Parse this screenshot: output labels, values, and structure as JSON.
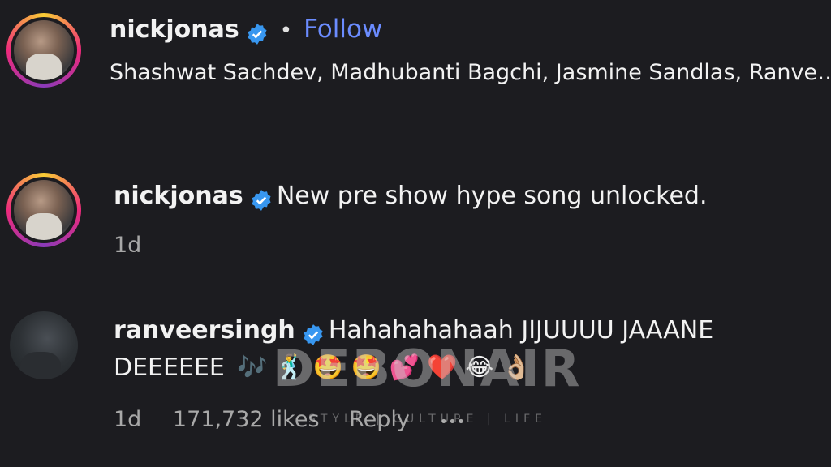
{
  "post_header": {
    "username": "nickjonas",
    "follow_label": "Follow",
    "separator": "•",
    "collaborators": "Shashwat Sachdev, Madhubanti Bagchi, Jasmine Sandlas, Ranve…"
  },
  "caption": {
    "username": "nickjonas",
    "text": "New pre show hype song unlocked.",
    "time": "1d"
  },
  "comment": {
    "username": "ranveersingh",
    "text_line1": "Hahahahahaah JIJUUUU JAAANE",
    "text_line2": "DEEEEEE",
    "emojis": "🎶 🕺 🤩 🤩 💕 ❤️ 😂 👌🏼",
    "time": "1d",
    "likes": "171,732 likes",
    "reply_label": "Reply",
    "more_label": "•••"
  },
  "watermark": {
    "brand": "DEBONAIR",
    "tagline": "STYLE | CULTURE | LIFE"
  },
  "colors": {
    "background": "#1c1c20",
    "verified": "#3897f0",
    "follow": "#6b8cff"
  }
}
